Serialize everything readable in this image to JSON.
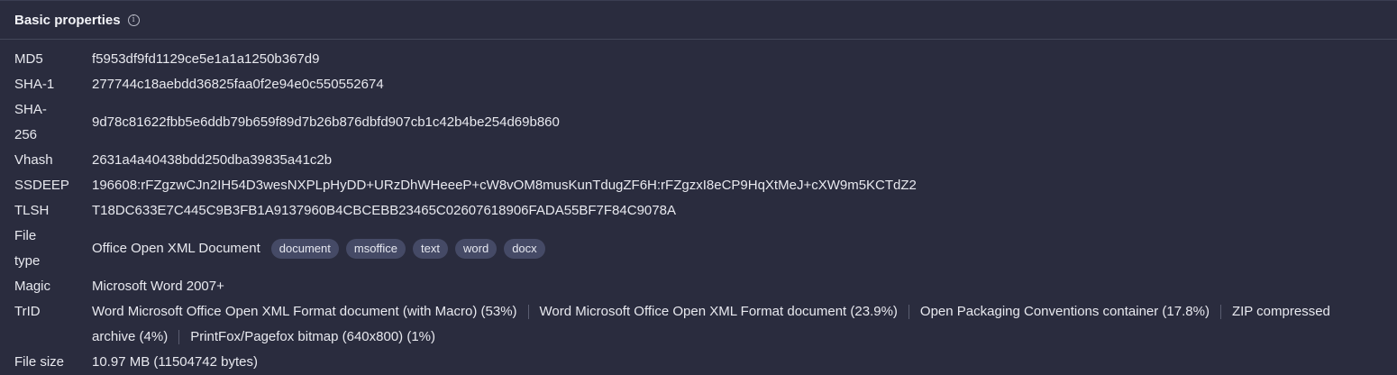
{
  "header": {
    "title": "Basic properties",
    "info_icon": "info-icon"
  },
  "props": {
    "md5": {
      "label": "MD5",
      "value": "f5953df9fd1129ce5e1a1a1250b367d9"
    },
    "sha1": {
      "label": "SHA-1",
      "value": "277744c18aebdd36825faa0f2e94e0c550552674"
    },
    "sha256": {
      "label": "SHA-256",
      "value": "9d78c81622fbb5e6ddb79b659f89d7b26b876dbfd907cb1c42b4be254d69b860"
    },
    "vhash": {
      "label": "Vhash",
      "value": "2631a4a40438bdd250dba39835a41c2b"
    },
    "ssdeep": {
      "label": "SSDEEP",
      "value": "196608:rFZgzwCJn2IH54D3wesNXPLpHyDD+URzDhWHeeeP+cW8vOM8musKunTdugZF6H:rFZgzxI8eCP9HqXtMeJ+cXW9m5KCTdZ2"
    },
    "tlsh": {
      "label": "TLSH",
      "value": "T18DC633E7C445C9B3FB1A9137960B4CBCEBB23465C02607618906FADA55BF7F84C9078A"
    },
    "filetype": {
      "label": "File type",
      "value": "Office Open XML Document",
      "tags": [
        "document",
        "msoffice",
        "text",
        "word",
        "docx"
      ]
    },
    "magic": {
      "label": "Magic",
      "value": "Microsoft Word 2007+"
    },
    "trid": {
      "label": "TrID",
      "entries": [
        "Word Microsoft Office Open XML Format document (with Macro) (53%)",
        "Word Microsoft Office Open XML Format document (23.9%)",
        "Open Packaging Conventions container (17.8%)",
        "ZIP compressed archive (4%)",
        "PrintFox/Pagefox bitmap (640x800) (1%)"
      ]
    },
    "filesize": {
      "label": "File size",
      "value": "10.97 MB (11504742 bytes)"
    }
  }
}
